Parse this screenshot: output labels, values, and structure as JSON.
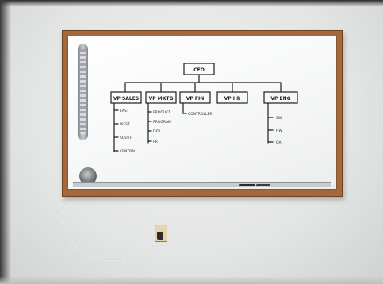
{
  "scene": {
    "description_tag": "photo",
    "colors": {
      "wall": "#e3e5e4",
      "frame": "#a4683a",
      "board": "#f7f8f8",
      "ink": "#1e1e1e"
    }
  },
  "orgchart": {
    "root": "CEO",
    "departments": [
      {
        "label": "VP SALES",
        "items": [
          "EAST",
          "WEST",
          "SOUTH",
          "CENTRAL"
        ]
      },
      {
        "label": "VP MKTG",
        "items": [
          "PRODUCT",
          "PROGRAM",
          "DEV",
          "PR"
        ]
      },
      {
        "label": "VP FIN",
        "items": [
          "CONTROLLER"
        ]
      },
      {
        "label": "VP HR",
        "items": []
      },
      {
        "label": "VP ENG",
        "items": [
          "SW",
          "HW",
          "QA"
        ]
      }
    ]
  }
}
